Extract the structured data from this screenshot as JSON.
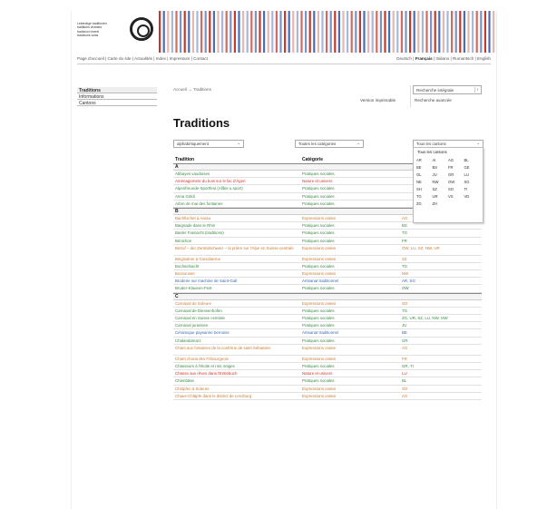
{
  "header": {
    "logo_lines": [
      "Lebendige traditionen",
      "traditions vivantes",
      "tradizioni viventi",
      "tradiziuns vivas"
    ],
    "top_nav": "Page d'accueil | Carte du site | Actualités | Index | Impressum | Contact",
    "lang_prefix": "Deutsch | ",
    "lang_active": "Français",
    "lang_suffix": " | Italiano | Rumantsch | English"
  },
  "sidebar": {
    "items": [
      {
        "label": "Traditions",
        "active": true
      },
      {
        "label": "Informations",
        "active": false
      },
      {
        "label": "Cantons",
        "active": false
      }
    ]
  },
  "main": {
    "breadcrumb": "Accueil → Traditions",
    "version": "Version imprimable",
    "search_label": "Recherche intégrale",
    "advanced_search": "Recherche avancée",
    "page_title": "Traditions",
    "filters": {
      "sort": "alphabétiquement",
      "category": "Toutes les catégories",
      "canton": "Tous les cantons"
    },
    "canton_dropdown": {
      "title": "Tous les cantons",
      "cantons": [
        "AR",
        "AI",
        "AG",
        "BL",
        "BE",
        "BS",
        "FR",
        "GE",
        "GL",
        "JU",
        "GR",
        "LU",
        "NE",
        "NW",
        "OW",
        "SG",
        "SH",
        "SZ",
        "SO",
        "TI",
        "TG",
        "UR",
        "VS",
        "VD",
        "ZG",
        "ZH"
      ]
    },
    "columns": [
      "Tradition",
      "Catégorie",
      ""
    ]
  },
  "groups": [
    {
      "letter": "A",
      "rows": [
        {
          "name": "Abbayes vaudoises",
          "cat": "Pratiques sociales",
          "canton": "",
          "color": "#3b8a45"
        },
        {
          "name": "Aménagement du bois sur le lac d'Ägeri",
          "cat": "Nature et univers",
          "canton": "",
          "color": "#d0352a"
        },
        {
          "name": "Alpenfreunde-Sportfest (Allbis-u.sport)",
          "cat": "Pratiques sociales",
          "canton": "",
          "color": "#3b8a45"
        },
        {
          "name": "Anna Göldi",
          "cat": "Pratiques sociales",
          "canton": "",
          "color": "#3b8a45"
        },
        {
          "name": "Arbre de mai des fontaines",
          "cat": "Pratiques sociales",
          "canton": "",
          "color": "#3b8a45"
        }
      ]
    },
    {
      "letter": "B",
      "rows": [
        {
          "name": "Bachfischet à Aarau",
          "cat": "Expressions orales",
          "canton": "AG",
          "color": "#cc7b2f"
        },
        {
          "name": "Baignade dans le Rhin",
          "cat": "Pratiques sociales",
          "canton": "BS",
          "color": "#3b8a45"
        },
        {
          "name": "Basler Fasnacht (traditions)",
          "cat": "Pratiques sociales",
          "canton": "TG",
          "color": "#3b8a45"
        },
        {
          "name": "Bénichon",
          "cat": "Pratiques sociales",
          "canton": "FR",
          "color": "#3b8a45"
        },
        {
          "name": "Betruf – der Zentralschweiz – la prière sur l'Alpe en Suisse centrale",
          "cat": "Expressions orales",
          "canton": "OW, LU, SZ, NW, UR",
          "color": "#cc7b2f",
          "tall": true
        },
        {
          "name": "Bingisalme à Giessbärme",
          "cat": "Expressions orales",
          "canton": "SZ",
          "color": "#cc7b2f"
        },
        {
          "name": "Bochselnacht",
          "cat": "Pratiques sociales",
          "canton": "TG",
          "color": "#3b8a45"
        },
        {
          "name": "Bossonnier",
          "cat": "Expressions orales",
          "canton": "NW",
          "color": "#cc7b2f"
        },
        {
          "name": "Broderie sur machine de Saint-Gall",
          "cat": "Artisanat traditionnel",
          "canton": "AR, SG",
          "color": "#3d6ab0"
        },
        {
          "name": "Bruder-Klausen-Fest",
          "cat": "Pratiques sociales",
          "canton": "OW",
          "color": "#3b8a45"
        }
      ]
    },
    {
      "letter": "C",
      "rows": [
        {
          "name": "Carnaval de Soleure",
          "cat": "Expressions orales",
          "canton": "SO",
          "color": "#cc7b2f"
        },
        {
          "name": "Carnaval de Diessenhofen",
          "cat": "Pratiques sociales",
          "canton": "TG",
          "color": "#3b8a45"
        },
        {
          "name": "Carnaval en Suisse centrale",
          "cat": "Pratiques sociales",
          "canton": "ZG, UR, SZ, LU, NW, OW",
          "color": "#3b8a45"
        },
        {
          "name": "Carnaval jurassien",
          "cat": "Pratiques sociales",
          "canton": "JU",
          "color": "#3b8a45"
        },
        {
          "name": "Céramique paysanne bernoise",
          "cat": "Artisanat traditionnel",
          "canton": "BE",
          "color": "#3d6ab0"
        },
        {
          "name": "Chalandamarz",
          "cat": "Pratiques sociales",
          "canton": "GR",
          "color": "#3b8a45"
        },
        {
          "name": "Chant aux fontaines de la confrérie de saint Sébastien",
          "cat": "Expressions orales",
          "canton": "AG",
          "color": "#cc7b2f",
          "tall": true
        },
        {
          "name": "Chant choral des Fribourgeois",
          "cat": "Expressions orales",
          "canton": "FR",
          "color": "#cc7b2f"
        },
        {
          "name": "Chasseurs à l'étoile et rois mages",
          "cat": "Pratiques sociales",
          "canton": "GR, TI",
          "color": "#3b8a45"
        },
        {
          "name": "Chasse aux rêves dans l'Entlebuch",
          "cat": "Nature et univers",
          "canton": "LU",
          "color": "#d0352a"
        },
        {
          "name": "Chienbäse",
          "cat": "Pratiques sociales",
          "canton": "BL",
          "color": "#3b8a45"
        },
        {
          "name": "Chlöpfen à Soleure",
          "cat": "Expressions orales",
          "canton": "SO",
          "color": "#cc7b2f"
        },
        {
          "name": "Chaus-Chläpfe dans le district de Lenzburg",
          "cat": "Expressions orales",
          "canton": "AG",
          "color": "#cc7b2f"
        }
      ]
    }
  ]
}
